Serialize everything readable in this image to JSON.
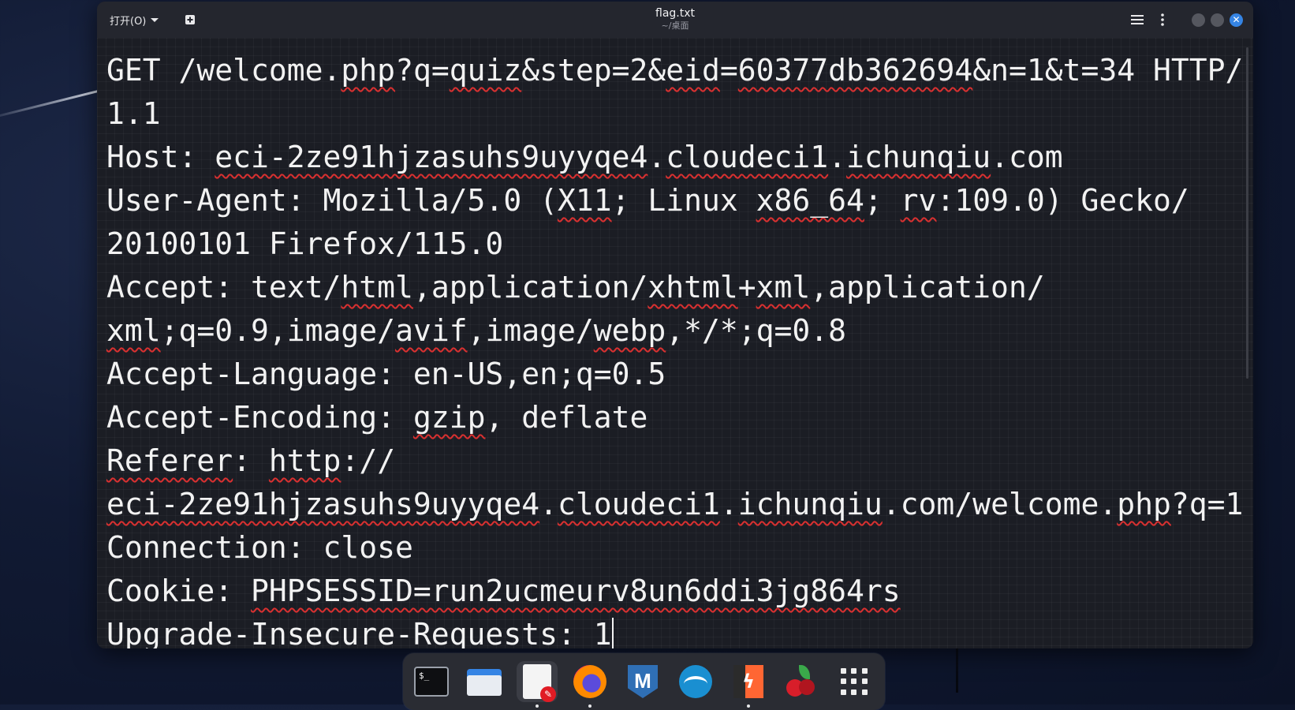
{
  "window": {
    "open_label": "打开(O)",
    "title": "flag.txt",
    "subtitle": "~/桌面"
  },
  "editor": {
    "lines": [
      {
        "parts": [
          {
            "t": "GET /welcome."
          },
          {
            "t": "php",
            "u": true
          },
          {
            "t": "?q="
          },
          {
            "t": "quiz",
            "u": true
          },
          {
            "t": "&step=2&"
          },
          {
            "t": "eid",
            "u": true
          },
          {
            "t": "="
          },
          {
            "t": "60377db362694",
            "u": true
          },
          {
            "t": "&n=1&t=34 HTTP/"
          }
        ]
      },
      {
        "parts": [
          {
            "t": "1.1"
          }
        ]
      },
      {
        "parts": [
          {
            "t": "Host: "
          },
          {
            "t": "eci-2ze91hjzasuhs9uyyqe4",
            "u": true
          },
          {
            "t": "."
          },
          {
            "t": "cloudeci1",
            "u": true
          },
          {
            "t": "."
          },
          {
            "t": "ichunqiu",
            "u": true
          },
          {
            "t": ".com"
          }
        ]
      },
      {
        "parts": [
          {
            "t": "User-Agent: Mozilla/5.0 ("
          },
          {
            "t": "X11",
            "u": true
          },
          {
            "t": "; Linux "
          },
          {
            "t": "x86_64",
            "u": true
          },
          {
            "t": "; "
          },
          {
            "t": "rv",
            "u": true
          },
          {
            "t": ":109.0) Gecko/"
          }
        ]
      },
      {
        "parts": [
          {
            "t": "20100101 Firefox/115.0"
          }
        ]
      },
      {
        "parts": [
          {
            "t": "Accept: text/"
          },
          {
            "t": "html",
            "u": true
          },
          {
            "t": ",application/"
          },
          {
            "t": "xhtml",
            "u": true
          },
          {
            "t": "+"
          },
          {
            "t": "xml",
            "u": true
          },
          {
            "t": ",application/"
          }
        ]
      },
      {
        "parts": [
          {
            "t": "xml",
            "u": true
          },
          {
            "t": ";q=0.9,image/"
          },
          {
            "t": "avif",
            "u": true
          },
          {
            "t": ",image/"
          },
          {
            "t": "webp",
            "u": true
          },
          {
            "t": ",*/*;q=0.8"
          }
        ]
      },
      {
        "parts": [
          {
            "t": "Accept-Language: en-US,en;q=0.5"
          }
        ]
      },
      {
        "parts": [
          {
            "t": "Accept-Encoding: "
          },
          {
            "t": "gzip",
            "u": true
          },
          {
            "t": ", deflate"
          }
        ]
      },
      {
        "parts": [
          {
            "t": "Referer",
            "u": true
          },
          {
            "t": ": "
          },
          {
            "t": "http",
            "u": true
          },
          {
            "t": "://"
          }
        ]
      },
      {
        "parts": [
          {
            "t": "eci-2ze91hjzasuhs9uyyqe4",
            "u": true
          },
          {
            "t": "."
          },
          {
            "t": "cloudeci1",
            "u": true
          },
          {
            "t": "."
          },
          {
            "t": "ichunqiu",
            "u": true
          },
          {
            "t": ".com/welcome."
          },
          {
            "t": "php",
            "u": true
          },
          {
            "t": "?q=1"
          }
        ]
      },
      {
        "parts": [
          {
            "t": "Connection: close"
          }
        ]
      },
      {
        "parts": [
          {
            "t": "Cookie: "
          },
          {
            "t": "PHPSESSID=run2ucmeurv8un6ddi3jg864rs",
            "u": true
          }
        ]
      },
      {
        "parts": [
          {
            "t": "Upgrade-Insecure-Requests: 1"
          }
        ],
        "cursor": true
      }
    ]
  },
  "dock": {
    "items": [
      {
        "name": "terminal-icon",
        "label": "$_"
      },
      {
        "name": "files-icon"
      },
      {
        "name": "text-editor-icon",
        "active": true
      },
      {
        "name": "firefox-icon"
      },
      {
        "name": "metasploit-icon",
        "label": "M"
      },
      {
        "name": "wireshark-icon"
      },
      {
        "name": "burpsuite-icon",
        "label": "ϟ"
      },
      {
        "name": "cherrytree-icon"
      },
      {
        "name": "app-grid-icon"
      }
    ]
  },
  "colors": {
    "accent": "#3584e4",
    "spell_underline": "#d93030"
  }
}
